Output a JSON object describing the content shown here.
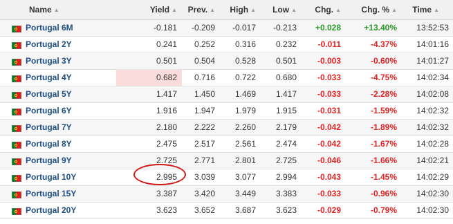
{
  "columns": {
    "name": "Name",
    "yield": "Yield",
    "prev": "Prev.",
    "high": "High",
    "low": "Low",
    "chg": "Chg.",
    "chg_pct": "Chg. %",
    "time": "Time"
  },
  "sort_icon": "sort-arrows-icon",
  "flag_icon": "portugal-flag-icon",
  "clock_icon": "clock-icon",
  "colors": {
    "up": "#2a9a2a",
    "down": "#e02424",
    "link": "#1e4d86",
    "highlight": "#fbdcdc",
    "annotation": "#d01818"
  },
  "rows": [
    {
      "name": "Portugal 6M",
      "yield": "-0.181",
      "prev": "-0.209",
      "high": "-0.017",
      "low": "-0.213",
      "chg": "+0.028",
      "chg_pct": "+13.40%",
      "time": "13:52:53",
      "dir": "up"
    },
    {
      "name": "Portugal 2Y",
      "yield": "0.241",
      "prev": "0.252",
      "high": "0.316",
      "low": "0.232",
      "chg": "-0.011",
      "chg_pct": "-4.37%",
      "time": "14:01:16",
      "dir": "down"
    },
    {
      "name": "Portugal 3Y",
      "yield": "0.501",
      "prev": "0.504",
      "high": "0.528",
      "low": "0.501",
      "chg": "-0.003",
      "chg_pct": "-0.60%",
      "time": "14:01:27",
      "dir": "down"
    },
    {
      "name": "Portugal 4Y",
      "yield": "0.682",
      "prev": "0.716",
      "high": "0.722",
      "low": "0.680",
      "chg": "-0.033",
      "chg_pct": "-4.75%",
      "time": "14:02:34",
      "dir": "down",
      "highlight_yield": true
    },
    {
      "name": "Portugal 5Y",
      "yield": "1.417",
      "prev": "1.450",
      "high": "1.469",
      "low": "1.417",
      "chg": "-0.033",
      "chg_pct": "-2.28%",
      "time": "14:02:08",
      "dir": "down"
    },
    {
      "name": "Portugal 6Y",
      "yield": "1.916",
      "prev": "1.947",
      "high": "1.979",
      "low": "1.915",
      "chg": "-0.031",
      "chg_pct": "-1.59%",
      "time": "14:02:32",
      "dir": "down"
    },
    {
      "name": "Portugal 7Y",
      "yield": "2.180",
      "prev": "2.222",
      "high": "2.260",
      "low": "2.179",
      "chg": "-0.042",
      "chg_pct": "-1.89%",
      "time": "14:02:32",
      "dir": "down"
    },
    {
      "name": "Portugal 8Y",
      "yield": "2.475",
      "prev": "2.517",
      "high": "2.561",
      "low": "2.474",
      "chg": "-0.042",
      "chg_pct": "-1.67%",
      "time": "14:02:28",
      "dir": "down"
    },
    {
      "name": "Portugal 9Y",
      "yield": "2.725",
      "prev": "2.771",
      "high": "2.801",
      "low": "2.725",
      "chg": "-0.046",
      "chg_pct": "-1.66%",
      "time": "14:02:21",
      "dir": "down"
    },
    {
      "name": "Portugal 10Y",
      "yield": "2.995",
      "prev": "3.039",
      "high": "3.077",
      "low": "2.994",
      "chg": "-0.043",
      "chg_pct": "-1.45%",
      "time": "14:02:29",
      "dir": "down",
      "circled": true
    },
    {
      "name": "Portugal 15Y",
      "yield": "3.387",
      "prev": "3.420",
      "high": "3.449",
      "low": "3.383",
      "chg": "-0.033",
      "chg_pct": "-0.96%",
      "time": "14:02:30",
      "dir": "down"
    },
    {
      "name": "Portugal 20Y",
      "yield": "3.623",
      "prev": "3.652",
      "high": "3.687",
      "low": "3.623",
      "chg": "-0.029",
      "chg_pct": "-0.79%",
      "time": "14:02:30",
      "dir": "down"
    }
  ]
}
